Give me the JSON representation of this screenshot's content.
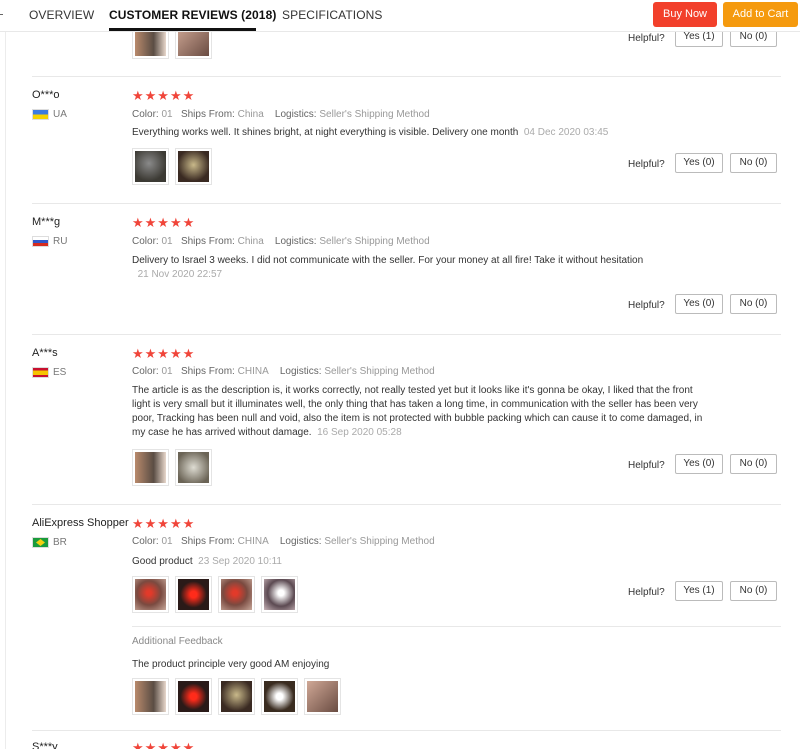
{
  "tabs": [
    {
      "label": "OVERVIEW"
    },
    {
      "label": "CUSTOMER REVIEWS (2018)"
    },
    {
      "label": "SPECIFICATIONS"
    }
  ],
  "buttons": {
    "buy_now": "Buy Now",
    "add_to_cart": "Add to Cart"
  },
  "helpful_label": "Helpful?",
  "meta_labels": {
    "color": "Color:",
    "ships_from": "Ships From:",
    "logistics": "Logistics:"
  },
  "stars": "★★★★★",
  "top_partial": {
    "yes": "Yes (1)",
    "no": "No (0)"
  },
  "reviews": [
    {
      "user": "O***o",
      "country": "UA",
      "color": "01",
      "ships_from": "China",
      "logistics": "Seller's Shipping Method",
      "text": "Everything works well. It shines bright, at night everything is visible. Delivery one month",
      "date": "04 Dec 2020 03:45",
      "yes": "Yes (0)",
      "no": "No (0)"
    },
    {
      "user": "M***g",
      "country": "RU",
      "color": "01",
      "ships_from": "China",
      "logistics": "Seller's Shipping Method",
      "text": "Delivery to Israel 3 weeks. I did not communicate with the seller. For your money at all fire! Take it without hesitation",
      "date": "21 Nov 2020 22:57",
      "yes": "Yes (0)",
      "no": "No (0)"
    },
    {
      "user": "A***s",
      "country": "ES",
      "color": "01",
      "ships_from": "CHINA",
      "logistics": "Seller's Shipping Method",
      "text": "The article is as the description is, it works correctly, not really tested yet but it looks like it's gonna be okay, I liked that the front light is very small but it illuminates well, the only thing that has taken a long time, in communication with the seller has been very poor, Tracking has been null and void, also the item is not protected with bubble packing which can cause it to come damaged, in my case he has arrived without damage.",
      "date": "16 Sep 2020 05:28",
      "yes": "Yes (0)",
      "no": "No (0)"
    },
    {
      "user": "AliExpress Shopper",
      "country": "BR",
      "color": "01",
      "ships_from": "CHINA",
      "logistics": "Seller's Shipping Method",
      "text": "Good product",
      "date": "23 Sep 2020 10:11",
      "yes": "Yes (1)",
      "no": "No (0)",
      "additional_label": "Additional Feedback",
      "additional_text": "The product principle very good AM enjoying"
    },
    {
      "user": "S***y"
    }
  ]
}
